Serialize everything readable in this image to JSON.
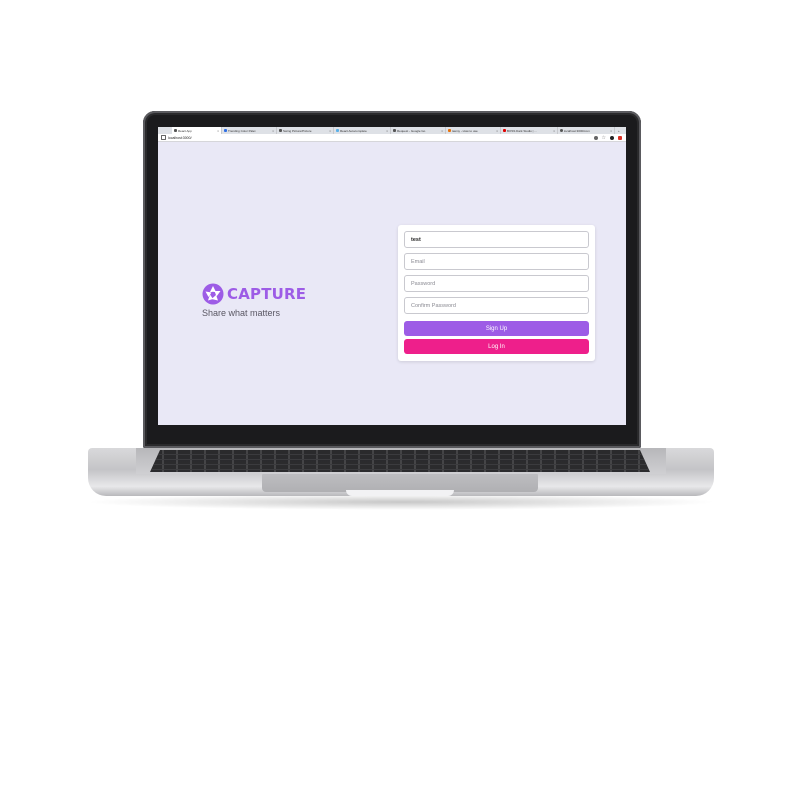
{
  "browser": {
    "tabs": [
      {
        "label": "React App",
        "active": true
      },
      {
        "label": "Trending Color Palet",
        "active": false
      },
      {
        "label": "Swing Picture/Picture",
        "active": false
      },
      {
        "label": "React Autocomplete",
        "active": false
      },
      {
        "label": "Request - Google Go",
        "active": false
      },
      {
        "label": "tasmy - How to use",
        "active": false
      },
      {
        "label": "BOSS Dark Studio | ...",
        "active": false
      },
      {
        "label": "localhost:3000/com",
        "active": false
      }
    ],
    "close_glyph": "×",
    "new_tab_glyph": "+",
    "url": "localhost:3000/",
    "star_glyph": "☆"
  },
  "brand": {
    "name": "CAPTURE",
    "tagline": "Share what matters",
    "color": "#9d5ce6"
  },
  "form": {
    "username_value": "test",
    "email_placeholder": "Email",
    "password_placeholder": "Password",
    "confirm_placeholder": "Confirm Password",
    "signup_label": "Sign Up",
    "login_label": "Log In",
    "signup_color": "#9d5ce6",
    "login_color": "#ee1f8b"
  }
}
